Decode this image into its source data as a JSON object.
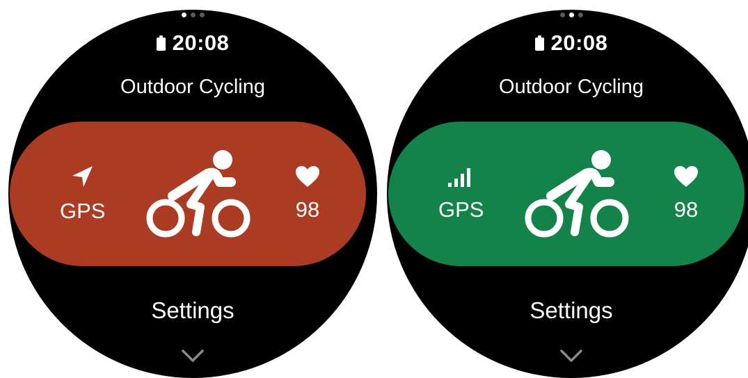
{
  "screens": [
    {
      "time": "20:08",
      "title": "Outdoor Cycling",
      "gps_label": "GPS",
      "gps_icon": "location-arrow-icon",
      "heart_rate": "98",
      "settings_label": "Settings",
      "pill_color": "#AC3B24",
      "active_page": 1,
      "page_count": 3
    },
    {
      "time": "20:08",
      "title": "Outdoor Cycling",
      "gps_label": "GPS",
      "gps_icon": "signal-bars-icon",
      "heart_rate": "98",
      "settings_label": "Settings",
      "pill_color": "#14834A",
      "active_page": 2,
      "page_count": 3
    }
  ]
}
